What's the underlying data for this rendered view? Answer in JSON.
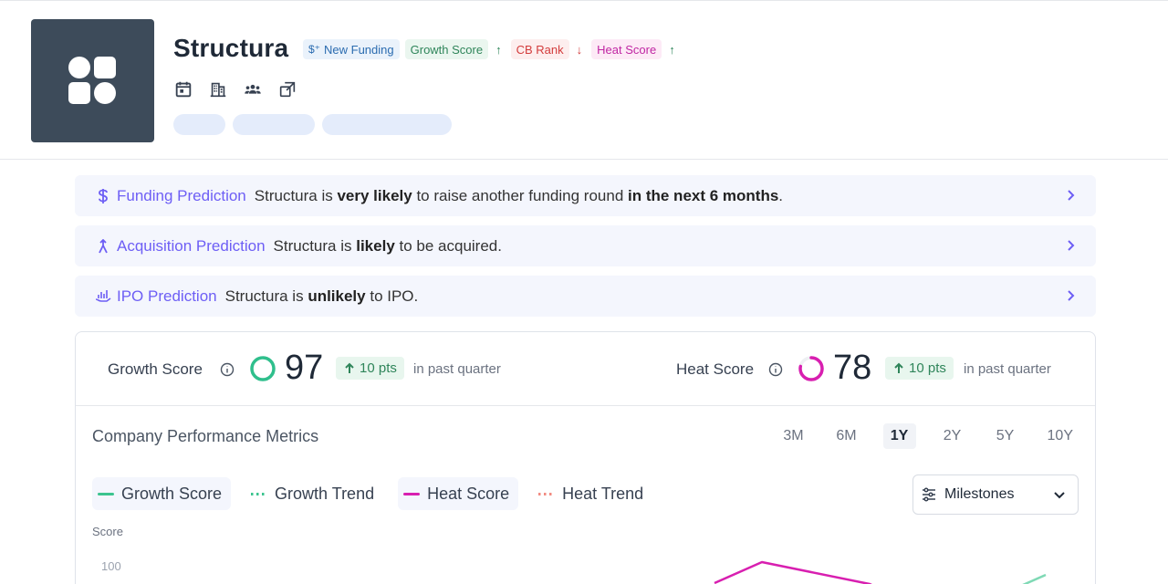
{
  "company": {
    "name": "Structura",
    "badges": [
      {
        "label": "New Funding",
        "prefix": "$⁺"
      },
      {
        "label": "Growth Score",
        "trend": "↑"
      },
      {
        "label": "CB Rank",
        "trend": "↓"
      },
      {
        "label": "Heat Score",
        "trend": "↑"
      }
    ],
    "quick_icons": [
      "calendar-icon",
      "building-icon",
      "people-icon",
      "external-link-icon"
    ]
  },
  "predictions": [
    {
      "title": "Funding Prediction",
      "icon": "dollar-icon",
      "text_pre": "Structura is ",
      "bold1": "very likely",
      "text_mid": " to raise another funding round ",
      "bold2": "in the next 6 months",
      "text_post": "."
    },
    {
      "title": "Acquisition Prediction",
      "icon": "merge-icon",
      "text_pre": "Structura is ",
      "bold1": "likely",
      "text_mid": " to be acquired.",
      "bold2": "",
      "text_post": ""
    },
    {
      "title": "IPO Prediction",
      "icon": "chart-hand-icon",
      "text_pre": "Structura is ",
      "bold1": "unlikely",
      "text_mid": " to IPO.",
      "bold2": "",
      "text_post": ""
    }
  ],
  "scores": {
    "growth": {
      "label": "Growth Score",
      "value": "97",
      "delta": "10 pts",
      "period": "in past quarter",
      "color": "#2fbf8c",
      "fraction": 0.97
    },
    "heat": {
      "label": "Heat Score",
      "value": "78",
      "delta": "10 pts",
      "period": "in past quarter",
      "color": "#d81fb0",
      "fraction": 0.78
    }
  },
  "metrics": {
    "title": "Company Performance Metrics",
    "ranges": [
      "3M",
      "6M",
      "1Y",
      "2Y",
      "5Y",
      "10Y"
    ],
    "active_range": "1Y",
    "legend": [
      {
        "label": "Growth Score",
        "style": "solid",
        "color": "#3cc48f"
      },
      {
        "label": "Growth Trend",
        "style": "dotted",
        "color": "#3cc48f"
      },
      {
        "label": "Heat Score",
        "style": "solid",
        "color": "#d81fb0"
      },
      {
        "label": "Heat Trend",
        "style": "dotted",
        "color": "#f28b82"
      }
    ],
    "milestones_label": "Milestones",
    "y_axis_title": "Score",
    "y_tick_top": "100"
  },
  "colors": {
    "accent": "#6d5ef5",
    "logo_bg": "#3d4b5a"
  }
}
